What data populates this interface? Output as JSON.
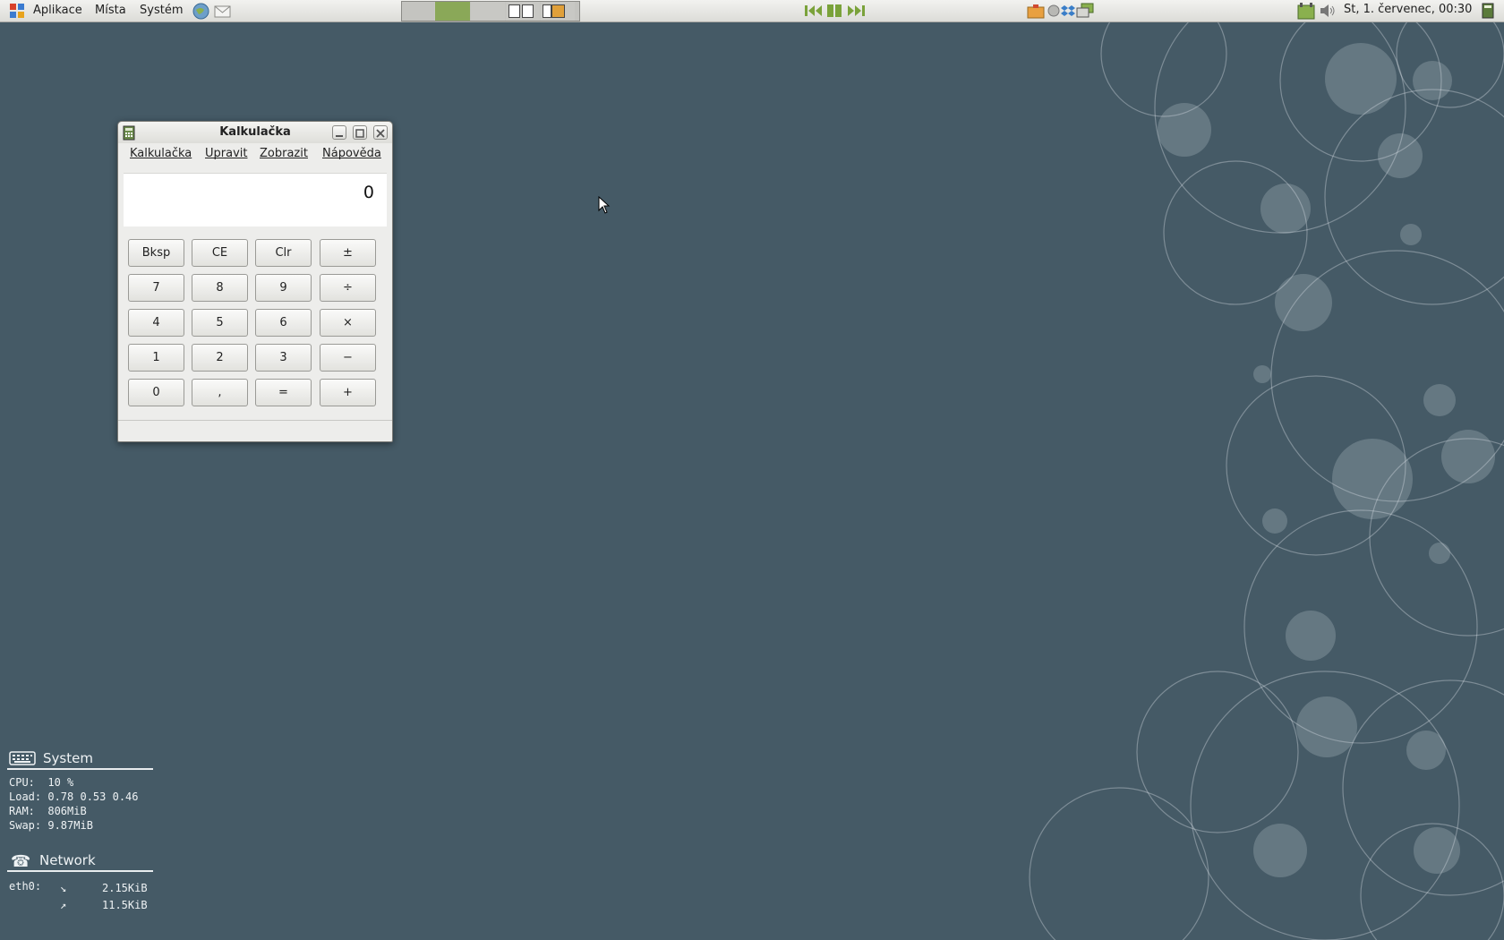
{
  "top_panel": {
    "menus": [
      "Aplikace",
      "Místa",
      "Systém"
    ],
    "clock": "St,  1. červenec, 00:30"
  },
  "calculator": {
    "title": "Kalkulačka",
    "menu": [
      "Kalkulačka",
      "Upravit",
      "Zobrazit",
      "Nápověda"
    ],
    "display": "0",
    "buttons": [
      [
        "Bksp",
        "CE",
        "Clr",
        "±"
      ],
      [
        "7",
        "8",
        "9",
        "÷"
      ],
      [
        "4",
        "5",
        "6",
        "×"
      ],
      [
        "1",
        "2",
        "3",
        "−"
      ],
      [
        "0",
        ",",
        "=",
        "+"
      ]
    ]
  },
  "conky": {
    "system_title": "System",
    "cpu": "CPU:  10 %",
    "load": "Load: 0.78 0.53 0.46",
    "ram": "RAM:  806MiB",
    "swap": "Swap: 9.87MiB",
    "network_title": "Network",
    "iface": "eth0:",
    "down_arrow": "↘",
    "down_value": "2.15KiB",
    "up_arrow": "↗",
    "up_value": "11.5KiB"
  },
  "colors": {
    "desktop_bg": "#455a66",
    "panel_bg": "#e8e8e4",
    "media_green": "#7aa23a"
  }
}
